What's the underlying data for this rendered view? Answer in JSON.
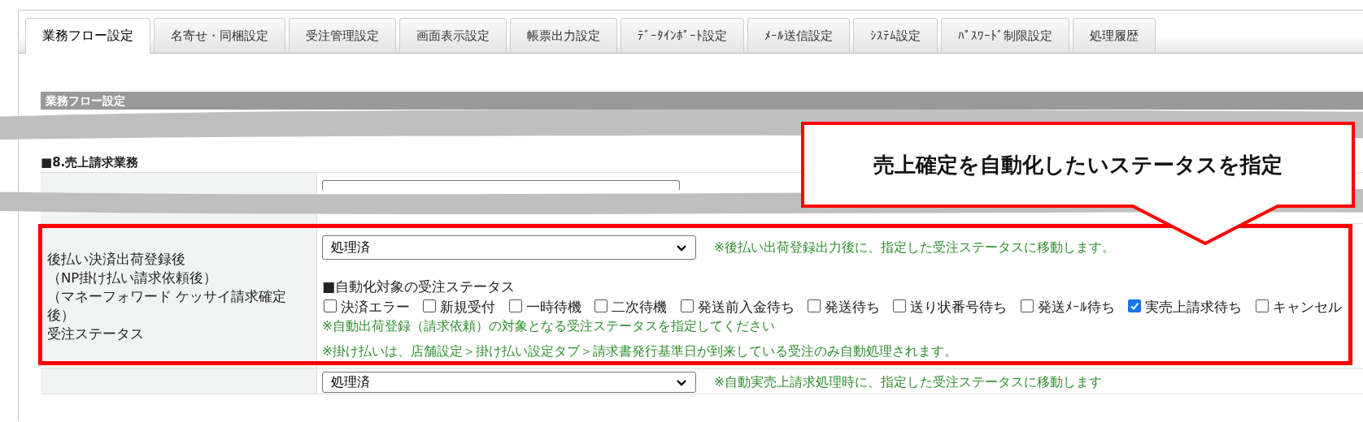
{
  "tabs": [
    {
      "label": "業務フロー設定",
      "selected": true
    },
    {
      "label": "名寄せ・同梱設定",
      "selected": false
    },
    {
      "label": "受注管理設定",
      "selected": false
    },
    {
      "label": "画面表示設定",
      "selected": false
    },
    {
      "label": "帳票出力設定",
      "selected": false
    },
    {
      "label": "ﾃﾞｰﾀｲﾝﾎﾟｰﾄ設定",
      "selected": false
    },
    {
      "label": "ﾒｰﾙ送信設定",
      "selected": false
    },
    {
      "label": "ｼｽﾃﾑ設定",
      "selected": false
    },
    {
      "label": "ﾊﾟｽﾜｰﾄﾞ制限設定",
      "selected": false
    },
    {
      "label": "処理履歴",
      "selected": false
    }
  ],
  "section_header": "業務フロー設定",
  "section_title": "■8.売上請求業務",
  "rows": [
    {
      "kind": "partial"
    },
    {
      "kind": "full",
      "label_lines": [
        "後払い決済出荷登録後",
        "（NP掛け払い請求依頼後）",
        "（マネーフォワード ケッサイ請求確定後）",
        "受注ステータス"
      ],
      "select_value": "処理済",
      "select_note": "※後払い出荷登録出力後に、指定した受注ステータスに移動します。",
      "sub_heading": "■自動化対象の受注ステータス",
      "statuses": [
        {
          "label": "決済エラー",
          "checked": false
        },
        {
          "label": "新規受付",
          "checked": false
        },
        {
          "label": "一時待機",
          "checked": false
        },
        {
          "label": "二次待機",
          "checked": false
        },
        {
          "label": "発送前入金待ち",
          "checked": false
        },
        {
          "label": "発送待ち",
          "checked": false
        },
        {
          "label": "送り状番号待ち",
          "checked": false
        },
        {
          "label": "発送ﾒｰﾙ待ち",
          "checked": false
        },
        {
          "label": "実売上請求待ち",
          "checked": true
        },
        {
          "label": "キャンセル",
          "checked": false
        }
      ],
      "hint": "※自動出荷登録（請求依頼）の対象となる受注ステータスを指定してください",
      "footnote": "※掛け払いは、店舗設定＞掛け払い設定タブ＞請求書発行基準日が到来している受注のみ自動処理されます。"
    },
    {
      "kind": "partial",
      "select_value": "処理済",
      "select_note": "※自動実売上請求処理時に、指定した受注ステータスに移動します"
    }
  ],
  "callout": {
    "text": "売上確定を自動化したいステータスを指定"
  }
}
